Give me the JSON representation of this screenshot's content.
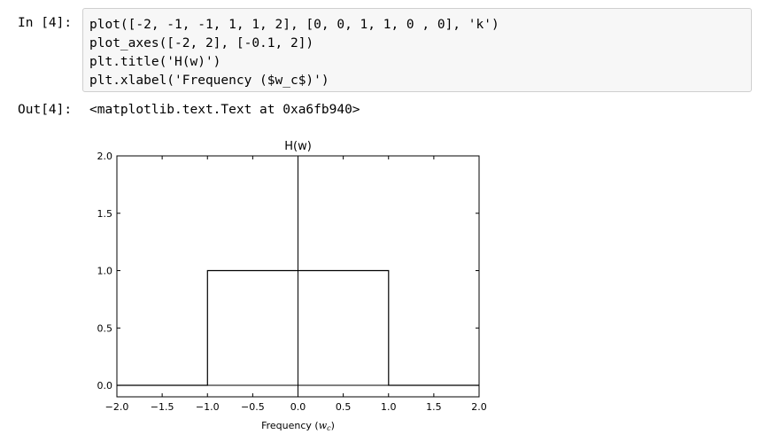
{
  "cell_in": {
    "prompt": "In [4]:",
    "lines": [
      "plot([-2, -1, -1, 1, 1, 2], [0, 0, 1, 1, 0 , 0], 'k')",
      "plot_axes([-2, 2], [-0.1, 2])",
      "plt.title('H(w)')",
      "plt.xlabel('Frequency ($w_c$)')"
    ]
  },
  "cell_out": {
    "prompt": "Out[4]:",
    "text": "<matplotlib.text.Text at 0xa6fb940>"
  },
  "chart_data": {
    "type": "line",
    "title": "H(w)",
    "xlabel_prefix": "Frequency (",
    "xlabel_math": "w",
    "xlabel_sub": "c",
    "xlabel_suffix": ")",
    "ylabel": "",
    "xlim": [
      -2,
      2
    ],
    "ylim": [
      -0.1,
      2
    ],
    "xticks": [
      -2.0,
      -1.5,
      -1.0,
      -0.5,
      0.0,
      0.5,
      1.0,
      1.5,
      2.0
    ],
    "xtick_labels": [
      "−2.0",
      "−1.5",
      "−1.0",
      "−0.5",
      "0.0",
      "0.5",
      "1.0",
      "1.5",
      "2.0"
    ],
    "yticks": [
      0.0,
      0.5,
      1.0,
      1.5,
      2.0
    ],
    "ytick_labels": [
      "0.0",
      "0.5",
      "1.0",
      "1.5",
      "2.0"
    ],
    "series": [
      {
        "x": [
          -2,
          -1,
          -1,
          1,
          1,
          2
        ],
        "y": [
          0,
          0,
          1,
          1,
          0,
          0
        ],
        "color": "#000000"
      }
    ],
    "axes_lines": {
      "x": 0,
      "y": 0
    },
    "grid": false
  }
}
